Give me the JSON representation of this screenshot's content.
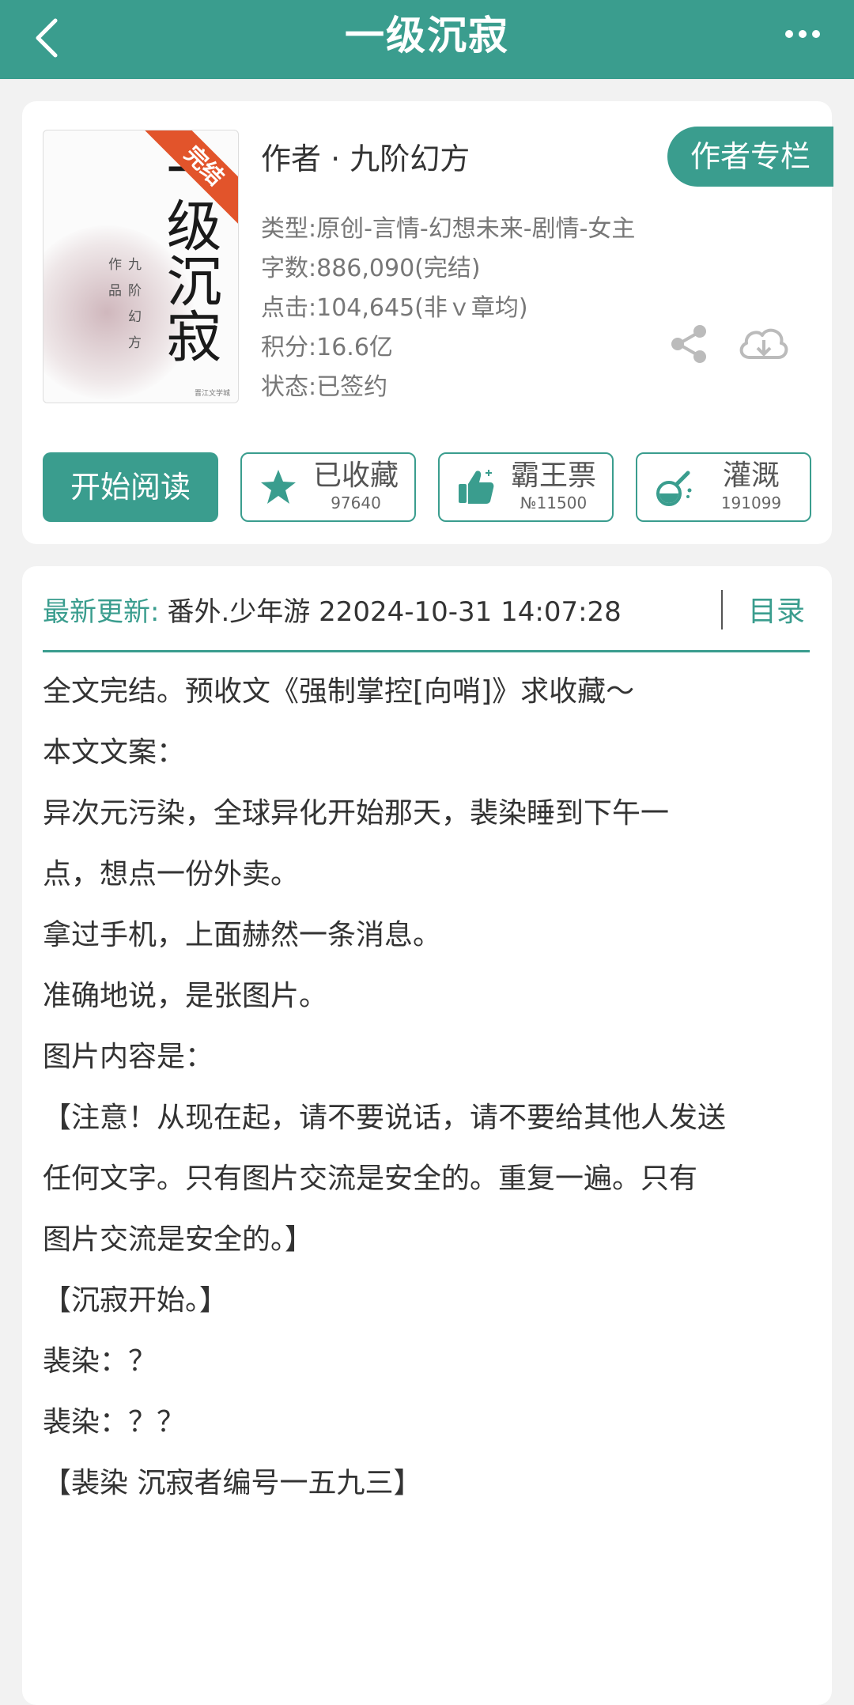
{
  "topbar": {
    "title": "一级沉寂",
    "back_icon": "chevron-left-icon",
    "more_icon": "more-dots-icon"
  },
  "book": {
    "cover": {
      "title": "一级沉寂",
      "ribbon": "完结",
      "author_vertical": "九阶幻方",
      "works": "作品",
      "publisher": "晋江文学城"
    },
    "author_line": "作者 · 九阶幻方",
    "author_column_label": "作者专栏",
    "meta": [
      "类型:原创-言情-幻想未来-剧情-女主",
      "字数:886,090(完结)",
      "点击:104,645(非ｖ章均)",
      "积分:16.6亿",
      "状态:已签约"
    ]
  },
  "actions": {
    "read_label": "开始阅读",
    "collect": {
      "label": "已收藏",
      "count": "97640"
    },
    "vote": {
      "label": "霸王票",
      "count": "№11500"
    },
    "nutrient": {
      "label": "灌溉",
      "count": "191099"
    }
  },
  "update": {
    "label": "最新更新:",
    "text": "番外.少年游 22024-10-31 14:07:28",
    "toc_label": "目录"
  },
  "content_lines": [
    "全文完结。预收文《强制掌控[向哨]》求收藏～",
    "本文文案：",
    "异次元污染，全球异化开始那天，裴染睡到下午一",
    "点，想点一份外卖。",
    "拿过手机，上面赫然一条消息。",
    "准确地说，是张图片。",
    "",
    "图片内容是：",
    "【注意！从现在起，请不要说话，请不要给其他人发送",
    "任何文字。只有图片交流是安全的。重复一遍。只有",
    "图片交流是安全的。】",
    "【沉寂开始。】",
    "",
    "裴染：？",
    "裴染：？？",
    "",
    "【裴染 沉寂者编号一五九三】"
  ],
  "colors": {
    "brand": "#3a9d8e",
    "ribbon": "#e2542b"
  }
}
